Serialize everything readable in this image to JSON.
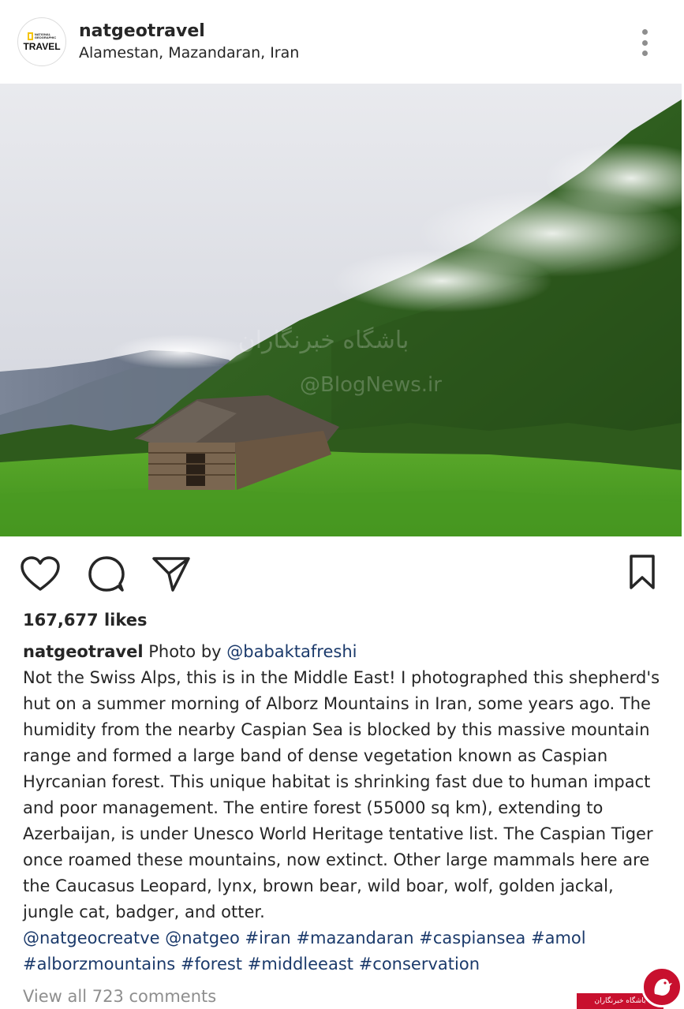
{
  "post": {
    "username": "natgeotravel",
    "location": "Alamestan, Mazandaran, Iran",
    "avatar": {
      "line1": "NATIONAL",
      "line2": "GEOGRAPHIC",
      "line3": "TRAVEL"
    }
  },
  "photo": {
    "watermark_line1": "باشگاه خبرنگاران",
    "watermark_line2": "@BlogNews.ir"
  },
  "actions": {
    "like_icon": "heart-icon",
    "comment_icon": "comment-icon",
    "share_icon": "send-icon",
    "save_icon": "bookmark-icon"
  },
  "likes": "167,677 likes",
  "caption": {
    "username": "natgeotravel",
    "intro": " Photo by ",
    "credit": "@babaktafreshi",
    "body": "Not the Swiss Alps, this is in the Middle East! I photographed this shepherd's hut on a summer morning of Alborz Mountains in Iran, some years ago. The humidity from the nearby Caspian Sea is blocked by this massive mountain range and formed a large band of dense vegetation known as Caspian Hyrcanian forest. This unique habitat is shrinking fast due to human impact and poor management. The entire forest (55000 sq km), extending to Azerbaijan, is under Unesco World Heritage tentative list. The Caspian Tiger once roamed these mountains, now extinct. Other large mammals here are the Caucasus Leopard, lynx, brown bear, wild boar, wolf, golden jackal, jungle cat, badger, and otter.",
    "tags": [
      "@natgeocreatve",
      "@natgeo",
      "#iran",
      "#mazandaran",
      "#caspiansea",
      "#amol",
      "#alborzmountains",
      "#forest",
      "#middleeast",
      "#conservation"
    ]
  },
  "view_all_comments": "View all 723 comments",
  "badge": {
    "text": "باشگاه خبرنگاران"
  },
  "colors": {
    "link": "#1b3a6b",
    "muted": "#8e8e8e",
    "badge_red": "#c8102e"
  }
}
